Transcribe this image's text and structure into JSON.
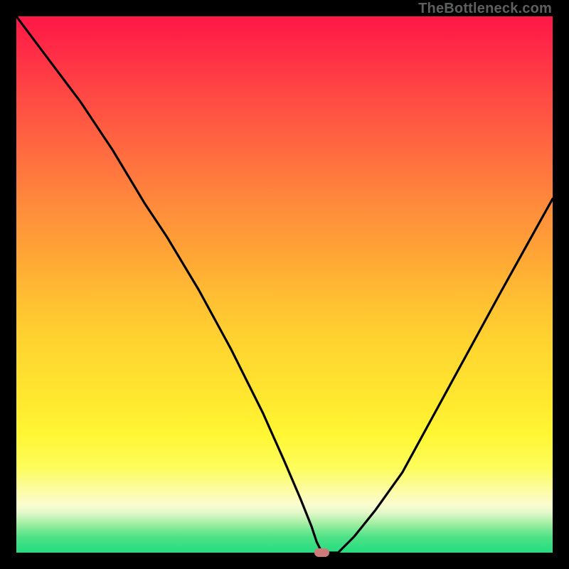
{
  "watermark": {
    "text": "TheBottleneck.com"
  },
  "colors": {
    "frame": "#000000",
    "curve_stroke": "#000000",
    "annotation_fill": "#cf7a79",
    "gradient_top": "#ff1747",
    "gradient_mid": "#ffe52f",
    "gradient_bottom": "#24dc80"
  },
  "chart_data": {
    "type": "line",
    "title": "",
    "xlabel": "",
    "ylabel": "",
    "xlim": [
      0,
      100
    ],
    "ylim": [
      0,
      100
    ],
    "grid": false,
    "legend": false,
    "axes_labeled": false,
    "series": [
      {
        "name": "bottleneck-curve",
        "x": [
          0,
          6,
          12,
          18,
          24,
          28,
          34,
          40,
          46,
          50,
          53,
          55,
          56,
          57,
          58,
          60,
          63,
          67,
          72,
          78,
          84,
          90,
          95,
          100
        ],
        "values": [
          100,
          92,
          84,
          75,
          65,
          59,
          49,
          38,
          26,
          17,
          10,
          5,
          2,
          0,
          0,
          0,
          3,
          8,
          15,
          26,
          37,
          48,
          57,
          66
        ]
      }
    ],
    "annotation": {
      "name": "minimum-marker",
      "x": 57,
      "values": 0,
      "width_frac": 0.028,
      "height_frac": 0.017
    },
    "notes": "Axes are unlabeled in the source image; x and y normalized to 0–100. Curve descends from top-left, flattens near y=0 around x≈56–60, then rises toward the right edge."
  }
}
